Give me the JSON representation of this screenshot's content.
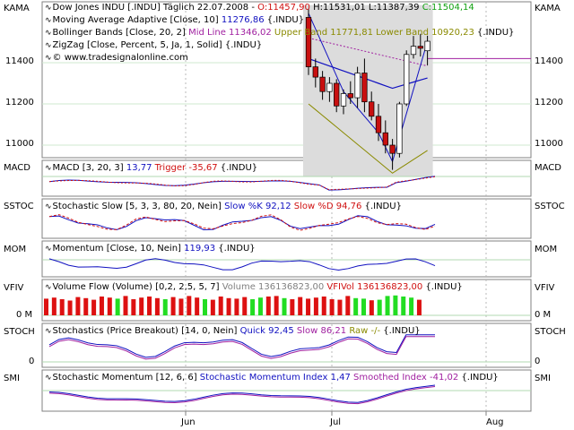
{
  "panels": {
    "kama": {
      "left_label": "KAMA",
      "right_label": "KAMA",
      "header_lines": [
        {
          "parts": [
            {
              "t": "Dow Jones INDU [.INDU]  Täglich  22.07.2008 - ",
              "c": "black"
            },
            {
              "t": "O:11457,90",
              "c": "red"
            },
            {
              "t": "  H:11531,01  L:11387,39  ",
              "c": "black"
            },
            {
              "t": "C:11504,14",
              "c": "green"
            }
          ]
        },
        {
          "parts": [
            {
              "t": "Moving Average Adaptive [Close, 10]  ",
              "c": "black"
            },
            {
              "t": "11276,86",
              "c": "blue"
            },
            {
              "t": "  {.INDU}",
              "c": "black"
            }
          ]
        },
        {
          "parts": [
            {
              "t": "Bollinger Bands [Close, 20, 2]  ",
              "c": "black"
            },
            {
              "t": "Mid Line 11346,02",
              "c": "purple"
            },
            {
              "t": "  Upper Band 11771,81  Lower Band 10920,23",
              "c": "olive"
            },
            {
              "t": "  {.INDU}",
              "c": "black"
            }
          ]
        },
        {
          "parts": [
            {
              "t": "ZigZag [Close, Percent, 5, Ja, 1, Solid]  {.INDU}",
              "c": "black"
            }
          ]
        },
        {
          "parts": [
            {
              "t": "© www.tradesignalonline.com",
              "c": "black"
            }
          ]
        }
      ],
      "y_ticks": [
        "11400",
        "11200",
        "11000"
      ]
    },
    "macd": {
      "left_label": "MACD",
      "right_label": "MACD",
      "header": [
        {
          "t": "MACD [3, 20, 3]  ",
          "c": "black"
        },
        {
          "t": "13,77",
          "c": "blue"
        },
        {
          "t": "  Trigger  -35,67",
          "c": "red"
        },
        {
          "t": "  {.INDU}",
          "c": "black"
        }
      ]
    },
    "sslow": {
      "left_label": "SSTOC",
      "right_label": "SSTOC",
      "header": [
        {
          "t": "Stochastic Slow [5, 3, 3, 80, 20, Nein]  ",
          "c": "black"
        },
        {
          "t": "Slow %K 92,12",
          "c": "blue"
        },
        {
          "t": "  Slow %D 94,76",
          "c": "red"
        },
        {
          "t": "  {.INDU}",
          "c": "black"
        }
      ]
    },
    "mom": {
      "left_label": "MOM",
      "right_label": "MOM",
      "header": [
        {
          "t": "Momentum [Close, 10, Nein]  ",
          "c": "black"
        },
        {
          "t": "119,93",
          "c": "blue"
        },
        {
          "t": "  {.INDU}",
          "c": "black"
        }
      ]
    },
    "vfi": {
      "left_label": "VFIV",
      "right_label": "VFIV",
      "y_tick": "0 M",
      "header": [
        {
          "t": "Volume Flow (Volume) [0,2, 2,5, 5, 7]  ",
          "c": "black"
        },
        {
          "t": "Volume  136136823,00",
          "c": "gray"
        },
        {
          "t": "  VFIVol 136136823,00",
          "c": "red"
        },
        {
          "t": "  {.INDU}",
          "c": "black"
        }
      ]
    },
    "stoch": {
      "left_label": "STOCH",
      "right_label": "STOCH",
      "y_tick": "0",
      "header": [
        {
          "t": "Stochastics (Price Breakout) [14, 0, Nein]  ",
          "c": "black"
        },
        {
          "t": "Quick 92,45",
          "c": "blue"
        },
        {
          "t": "  Slow 86,21",
          "c": "purple"
        },
        {
          "t": "  Raw -/-",
          "c": "olive"
        },
        {
          "t": "  {.INDU}",
          "c": "black"
        }
      ]
    },
    "smi": {
      "left_label": "SMI",
      "right_label": "SMI",
      "header": [
        {
          "t": "Stochastic Momentum [12, 6, 6]  ",
          "c": "black"
        },
        {
          "t": "Stochastic Momentum Index 1,47",
          "c": "blue"
        },
        {
          "t": "  Smoothed Index -41,02",
          "c": "purple"
        },
        {
          "t": "  {.INDU}",
          "c": "black"
        }
      ]
    }
  },
  "x_axis": {
    "labels": [
      "Jun",
      "Jul",
      "Aug"
    ]
  },
  "colors": {
    "blue": "#1010c0",
    "red": "#d01010",
    "green": "#10a010",
    "purple": "#a020a0",
    "olive": "#8a8a00",
    "gray": "#808080",
    "candle_up": "#ffffff",
    "candle_down": "#c81010",
    "volume_up": "#22dd22",
    "volume_down": "#dd1111",
    "band_fill": "#dcdcdc"
  },
  "chart_data": {
    "type": "candlestick",
    "title": "Dow Jones INDU [.INDU]",
    "last_bar": {
      "date": "22.07.2008",
      "open": 11457.9,
      "high": 11531.01,
      "low": 11387.39,
      "close": 11504.14
    },
    "candles": [
      {
        "o": 11620,
        "h": 11660,
        "l": 11340,
        "c": 11380
      },
      {
        "o": 11380,
        "h": 11420,
        "l": 11280,
        "c": 11330
      },
      {
        "o": 11330,
        "h": 11360,
        "l": 11220,
        "c": 11260
      },
      {
        "o": 11260,
        "h": 11330,
        "l": 11210,
        "c": 11300
      },
      {
        "o": 11300,
        "h": 11320,
        "l": 11160,
        "c": 11190
      },
      {
        "o": 11190,
        "h": 11270,
        "l": 11150,
        "c": 11250
      },
      {
        "o": 11250,
        "h": 11310,
        "l": 11200,
        "c": 11230
      },
      {
        "o": 11230,
        "h": 11380,
        "l": 11180,
        "c": 11350
      },
      {
        "o": 11350,
        "h": 11420,
        "l": 11160,
        "c": 11210
      },
      {
        "o": 11210,
        "h": 11260,
        "l": 11120,
        "c": 11140
      },
      {
        "o": 11140,
        "h": 11200,
        "l": 11020,
        "c": 11060
      },
      {
        "o": 11060,
        "h": 11120,
        "l": 10960,
        "c": 11000
      },
      {
        "o": 11000,
        "h": 11030,
        "l": 10880,
        "c": 10960
      },
      {
        "o": 10960,
        "h": 11210,
        "l": 10940,
        "c": 11200
      },
      {
        "o": 11200,
        "h": 11460,
        "l": 11190,
        "c": 11440
      },
      {
        "o": 11440,
        "h": 11530,
        "l": 11420,
        "c": 11480
      },
      {
        "o": 11480,
        "h": 11540,
        "l": 11430,
        "c": 11470
      },
      {
        "o": 11457.9,
        "h": 11531.01,
        "l": 11387.39,
        "c": 11504.14
      }
    ],
    "volume_flow": {
      "values": [
        62,
        66,
        60,
        55,
        68,
        64,
        58,
        70,
        66,
        62,
        72,
        60,
        66,
        70,
        64,
        60,
        68,
        62,
        72,
        66,
        60,
        58,
        70,
        64,
        62,
        68,
        60,
        66,
        70,
        72,
        64,
        60,
        68,
        62,
        66,
        70,
        60,
        58,
        72,
        64,
        62,
        56,
        58,
        72,
        74,
        70,
        66,
        58
      ],
      "up": [
        false,
        false,
        false,
        false,
        false,
        false,
        false,
        false,
        false,
        true,
        false,
        false,
        false,
        false,
        false,
        true,
        false,
        false,
        false,
        false,
        true,
        false,
        false,
        false,
        false,
        false,
        true,
        true,
        false,
        false,
        true,
        false,
        false,
        false,
        false,
        false,
        false,
        false,
        false,
        true,
        true,
        false,
        true,
        true,
        true,
        true,
        true,
        false
      ]
    }
  }
}
